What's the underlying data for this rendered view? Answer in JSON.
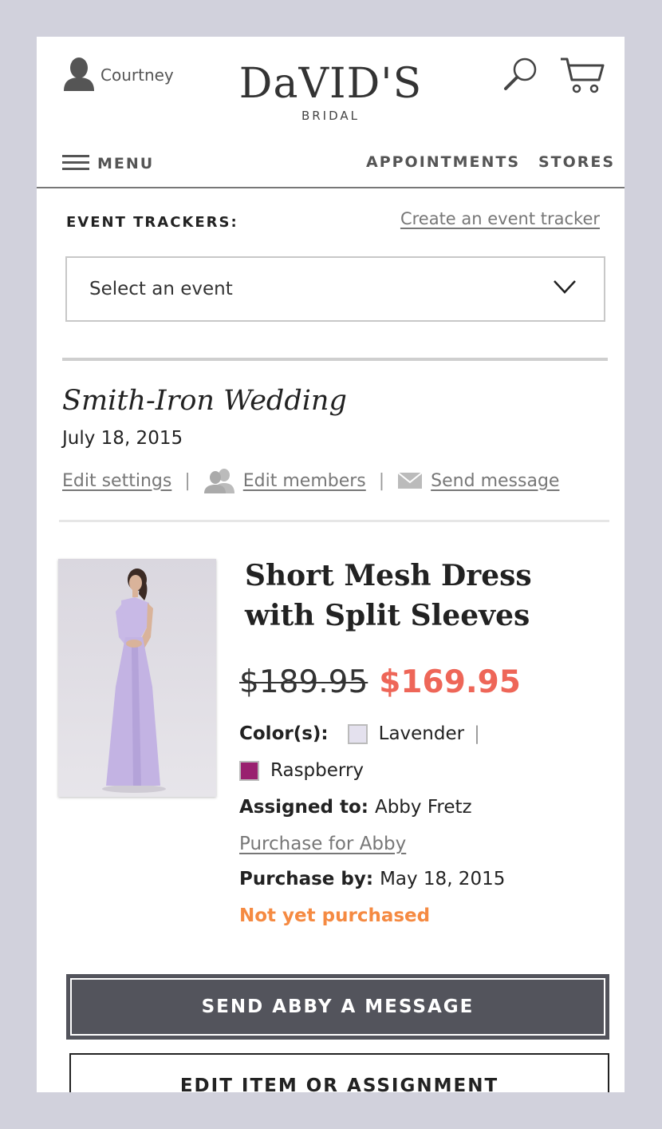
{
  "header": {
    "user_name": "Courtney",
    "logo_main": "DaVID'S",
    "logo_sub": "BRIDAL",
    "icons": [
      "user-icon",
      "search-icon",
      "cart-icon"
    ]
  },
  "nav": {
    "menu_label": "MENU",
    "appointments": "APPOINTMENTS",
    "stores": "STORES"
  },
  "event_tracker": {
    "label": "EVENT TRACKERS:",
    "create_link": "Create an event tracker",
    "select_value": "Select an event"
  },
  "event": {
    "name": "Smith-Iron Wedding",
    "date": "July 18, 2015",
    "edit_settings": "Edit settings",
    "edit_members": "Edit members",
    "send_message": "Send message",
    "separator": "|"
  },
  "product": {
    "title": "Short Mesh Dress with Split Sleeves",
    "price_original": "$189.95",
    "price_sale": "$169.95",
    "colors_label": "Color(s):",
    "colors": [
      {
        "name": "Lavender",
        "hex": "#e4e1ee"
      },
      {
        "name": "Raspberry",
        "hex": "#99206f"
      }
    ],
    "assigned_label": "Assigned to:",
    "assigned_to": "Abby Fretz",
    "purchase_link": "Purchase for Abby",
    "purchase_by_label": "Purchase by:",
    "purchase_by": "May 18, 2015",
    "status": "Not yet purchased"
  },
  "buttons": {
    "send_message": "SEND ABBY A MESSAGE",
    "edit_item": "EDIT ITEM OR ASSIGNMENT"
  },
  "colors": {
    "sale": "#ee6658",
    "status": "#f58a42",
    "primary_button": "#53545c",
    "background": "#d1d1dc"
  }
}
